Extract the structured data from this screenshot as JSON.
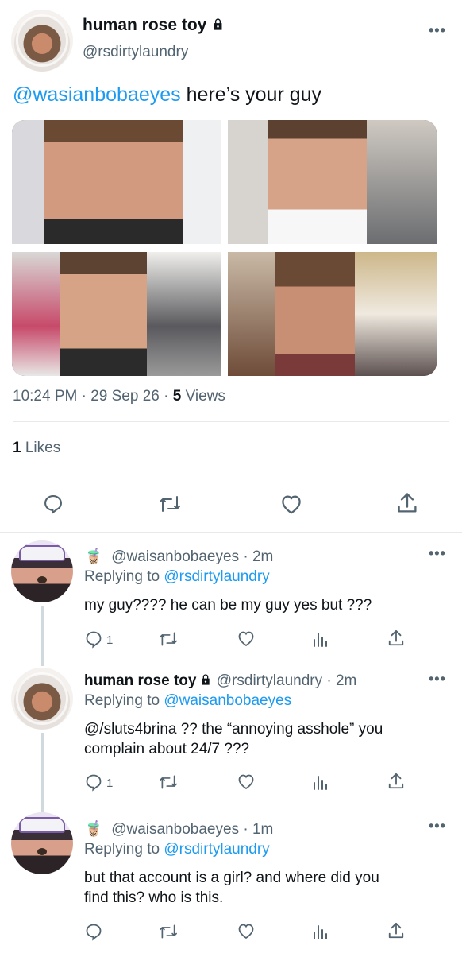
{
  "tweet": {
    "display_name": "human rose toy",
    "handle": "@rsdirtylaundry",
    "mention": "@wasianbobaeyes",
    "text_rest": " here’s your guy",
    "time": "10:24 PM · 29 Sep 26 · ",
    "views_count": "5",
    "views_label": " Views",
    "likes_count": "1",
    "likes_label": " Likes",
    "more_label": "•••"
  },
  "replies": [
    {
      "emoji": "🧋",
      "handle_time": "@waisanbobaeyes · 2m",
      "replying_label": "Replying to ",
      "replying_to": "@rsdirtylaundry",
      "text": "my guy???? he can be my guy yes but ???",
      "reply_count": "1"
    },
    {
      "display_name": "human rose toy",
      "handle_time": "@rsdirtylaundry · 2m",
      "replying_label": "Replying to ",
      "replying_to": "@waisanbobaeyes",
      "text_line1": "@/sluts4brina ?? the “annoying asshole” you",
      "text_line2": "complain about 24/7 ???",
      "reply_count": "1"
    },
    {
      "emoji": "🧋",
      "handle_time": "@waisanbobaeyes · 1m",
      "replying_label": "Replying to ",
      "replying_to": "@rsdirtylaundry",
      "text_line1": "but that account is a girl? and where did you",
      "text_line2": "find this? who is this."
    }
  ],
  "colors": {
    "accent": "#1d9bf0",
    "secondary": "#536471",
    "divider": "#e7e9ea"
  },
  "icons": [
    "reply-icon",
    "retweet-icon",
    "like-icon",
    "share-icon",
    "views-icon",
    "lock-icon",
    "more-icon"
  ]
}
